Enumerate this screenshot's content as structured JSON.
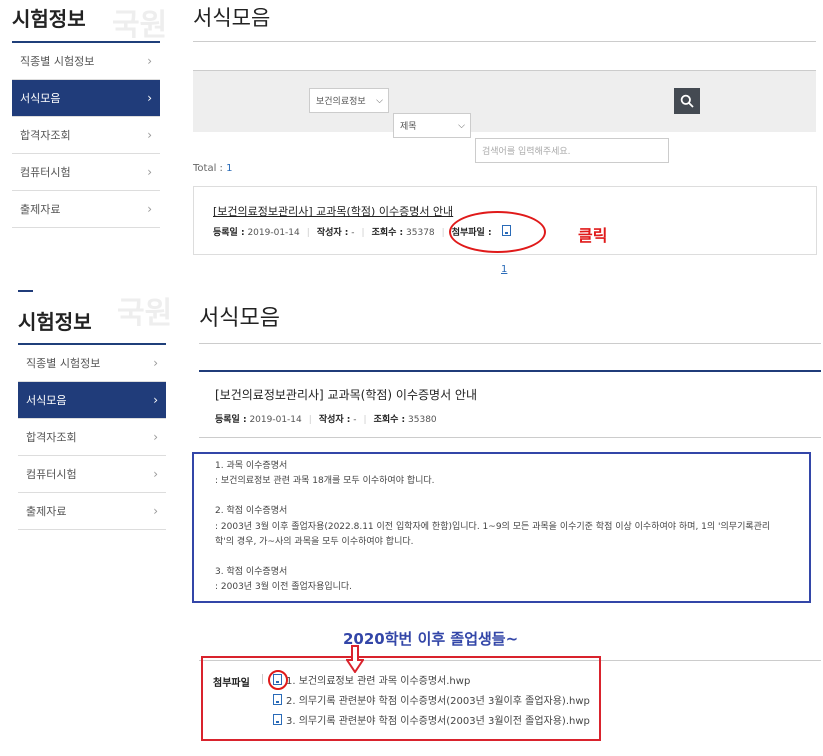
{
  "top": {
    "sidebar": {
      "title": "시험정보",
      "watermark": "국원",
      "items": [
        {
          "label": "직종별 시험정보",
          "active": false
        },
        {
          "label": "서식모음",
          "active": true
        },
        {
          "label": "합격자조회",
          "active": false
        },
        {
          "label": "컴퓨터시험",
          "active": false
        },
        {
          "label": "출제자료",
          "active": false
        }
      ]
    },
    "page_title": "서식모음",
    "search": {
      "category_value": "보건의료정보",
      "field_value": "제목",
      "placeholder": "검색어를 입력해주세요."
    },
    "total_label": "Total :",
    "total_count": "1",
    "post": {
      "title": "[보건의료정보관리사] 교과목(학점) 이수증명서 안내",
      "date_label": "등록일 :",
      "date": "2019-01-14",
      "author_label": "작성자 :",
      "author": "-",
      "views_label": "조회수 :",
      "views": "35378",
      "attach_label": "첨부파일 :"
    },
    "click_annotation": "클릭",
    "page_number": "1"
  },
  "bottom": {
    "sidebar": {
      "title": "시험정보",
      "watermark": "국원",
      "items": [
        {
          "label": "직종별 시험정보",
          "active": false
        },
        {
          "label": "서식모음",
          "active": true
        },
        {
          "label": "합격자조회",
          "active": false
        },
        {
          "label": "컴퓨터시험",
          "active": false
        },
        {
          "label": "출제자료",
          "active": false
        }
      ]
    },
    "page_title": "서식모음",
    "post": {
      "title": "[보건의료정보관리사] 교과목(학점) 이수증명서 안내",
      "date_label": "등록일 :",
      "date": "2019-01-14",
      "author_label": "작성자 :",
      "author": "-",
      "views_label": "조회수 :",
      "views": "35380"
    },
    "body": [
      "1. 과목 이수증명서",
      " : 보건의료정보 관련 과목 18개를 모두 이수하여야 합니다.",
      "",
      "2. 학점 이수증명서",
      " : 2003년 3월 이후 졸업자용(2022.8.11 이전 입학자에 한함)입니다. 1~9의 모든 과목을 이수기준 학점 이상 이수하여야 하며, 1의 '의무기록관리",
      "학'의 경우, 가~사의 과목을 모두 이수하여야 합니다.",
      "",
      "3. 학점 이수증명서",
      " : 2003년 3월 이전 졸업자용입니다."
    ],
    "annotation": "2020학번 이후 졸업생들~",
    "attach_label": "첨부파일",
    "files": [
      "1. 보건의료정보 관련 과목 이수증명서.hwp",
      "2. 의무기록 관련분야 학점 이수증명서(2003년 3월이후 졸업자용).hwp",
      "3. 의무기록 관련분야 학점 이수증명서(2003년 3월이전 졸업자용).hwp"
    ]
  },
  "colors": {
    "nav_active": "#203c7a",
    "annotation_red": "#e01a1a",
    "annotation_blue": "#3346a8",
    "link_blue": "#2a6bb8"
  }
}
